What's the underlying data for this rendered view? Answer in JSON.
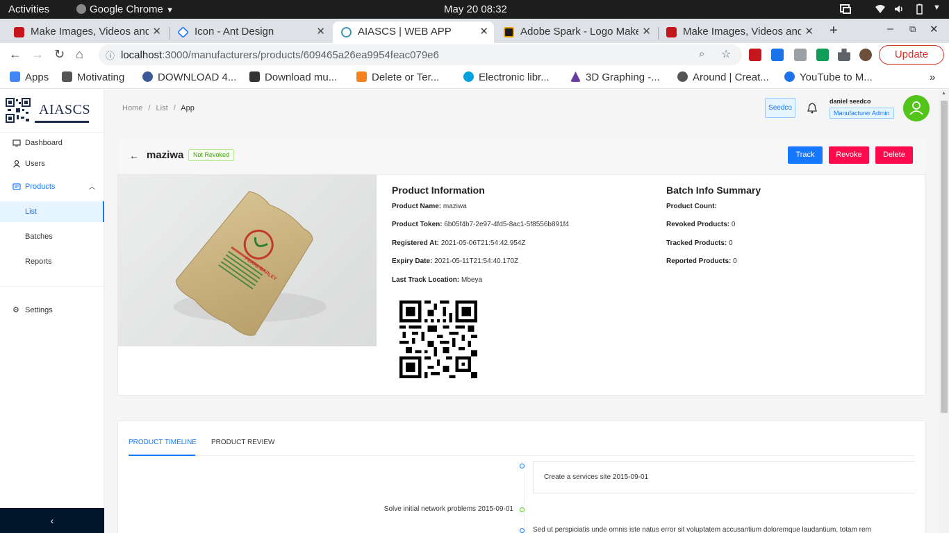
{
  "os_bar": {
    "activities": "Activities",
    "app_name": "Google Chrome",
    "clock": "May 20  08:32"
  },
  "browser": {
    "tabs": [
      {
        "title": "Make Images, Videos and",
        "favicon_color": "#c4161c"
      },
      {
        "title": "Icon - Ant Design",
        "favicon_color": "#1677ff"
      },
      {
        "title": "AIASCS | WEB APP",
        "favicon_color": "#61dafb"
      },
      {
        "title": "Adobe Spark - Logo Make",
        "favicon_color": "#e8a200"
      },
      {
        "title": "Make Images, Videos and",
        "favicon_color": "#c4161c"
      }
    ],
    "url_host": "localhost",
    "url_path": ":3000/manufacturers/products/609465a26ea9954feac079e6",
    "update_label": "Update",
    "bookmarks": [
      {
        "label": "Apps",
        "color": "#4285f4"
      },
      {
        "label": "Motivating",
        "color": "#555555"
      },
      {
        "label": "DOWNLOAD 4...",
        "color": "#3b5998"
      },
      {
        "label": "Download mu...",
        "color": "#333333"
      },
      {
        "label": "Delete or Ter...",
        "color": "#f5821f"
      },
      {
        "label": "Electronic libr...",
        "color": "#00a1e0"
      },
      {
        "label": "3D Graphing -...",
        "color": "#6a3ea1"
      },
      {
        "label": "Around | Creat...",
        "color": "#555555"
      },
      {
        "label": "YouTube to M...",
        "color": "#1a73e8"
      }
    ]
  },
  "sidebar": {
    "brand": "AIASCS",
    "items": [
      {
        "label": "Dashboard",
        "icon": "desktop-icon"
      },
      {
        "label": "Users",
        "icon": "user-icon"
      },
      {
        "label": "Products",
        "icon": "products-icon"
      },
      {
        "label": "List"
      },
      {
        "label": "Batches"
      },
      {
        "label": "Reports"
      },
      {
        "label": "Settings",
        "icon": "gear-icon"
      }
    ],
    "collapse_icon": "‹"
  },
  "header": {
    "breadcrumb": {
      "home": "Home",
      "list": "List",
      "current": "App",
      "sep": "/"
    },
    "org": "Seedco",
    "user_name": "daniel seedco",
    "user_role": "Manufacturer Admin"
  },
  "product": {
    "name": "maziwa",
    "status": "Not Revoked",
    "actions": {
      "track": "Track",
      "revoke": "Revoke",
      "delete": "Delete"
    },
    "info_title": "Product Information",
    "fields": [
      {
        "label": "Product Name:",
        "value": "maziwa"
      },
      {
        "label": "Product Token:",
        "value": "6b05f4b7-2e97-4fd5-8ac1-5f8556b891f4"
      },
      {
        "label": "Registered At:",
        "value": "2021-05-06T21:54:42.954Z"
      },
      {
        "label": "Expiry Date:",
        "value": "2021-05-11T21:54:40.170Z"
      },
      {
        "label": "Last Track Location:",
        "value": "Mbeya"
      }
    ],
    "batch_title": "Batch Info Summary",
    "batch": [
      {
        "label": "Product Count:",
        "value": ""
      },
      {
        "label": "Revoked Products:",
        "value": "0"
      },
      {
        "label": "Tracked Products:",
        "value": "0"
      },
      {
        "label": "Reported Products:",
        "value": "0"
      }
    ],
    "image_text": "PEARL BARLEY"
  },
  "timeline": {
    "tabs": [
      "PRODUCT TIMELINE",
      "PRODUCT REVIEW"
    ],
    "events": [
      {
        "text": "Create a services site 2015-09-01",
        "color": "#1677ff"
      },
      {
        "text": "Solve initial network problems 2015-09-01",
        "color": "#52c41a"
      },
      {
        "text": "Sed ut perspiciatis unde omnis iste natus error sit voluptatem accusantium doloremque laudantium, totam rem",
        "color": "#1677ff"
      }
    ]
  },
  "colors": {
    "primary": "#1677ff",
    "danger": "#ff0a4d",
    "success": "#52c41a",
    "sidebar_footer": "#001529"
  }
}
